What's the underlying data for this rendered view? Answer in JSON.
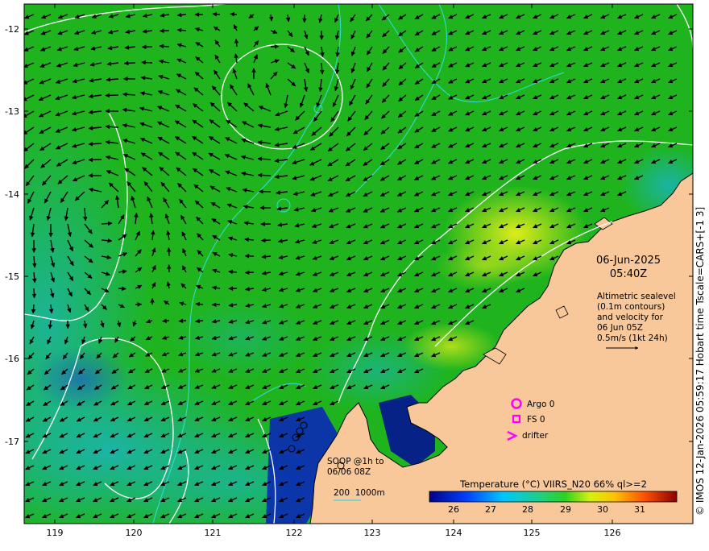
{
  "map": {
    "date": "06-Jun-2025",
    "time": "05:40Z",
    "altimetry": [
      "Altimetric sealevel",
      "(0.1m contours)",
      "and velocity for",
      "06 Jun 05Z",
      "0.5m/s (1kt 24h)"
    ],
    "legend": {
      "argo": "Argo 0",
      "fs": "FS 0",
      "drifter": "drifter"
    },
    "soop": [
      "SOOP @1h to",
      "06/06 08Z"
    ],
    "isobath_label": "200  1000m",
    "colorbar": {
      "title": "Temperature (°C) VIIRS_N20 66% ql>=2",
      "ticks": [
        "26",
        "27",
        "28",
        "29",
        "30",
        "31"
      ]
    },
    "lon_ticks": [
      "119",
      "120",
      "121",
      "122",
      "123",
      "124",
      "125",
      "126"
    ],
    "lat_ticks": [
      "-12",
      "-13",
      "-14",
      "-15",
      "-16",
      "-17"
    ],
    "credit": "© IMOS 12-Jan-2026 05:59:17 Hobart time Tscale=CARS+[-1 3]",
    "colors": {
      "land": "#f8c89a",
      "ocean_main": "#1fb41e",
      "marker": "#ff00ff",
      "contour": "#ffffff",
      "isobath": "#33dddd"
    }
  }
}
